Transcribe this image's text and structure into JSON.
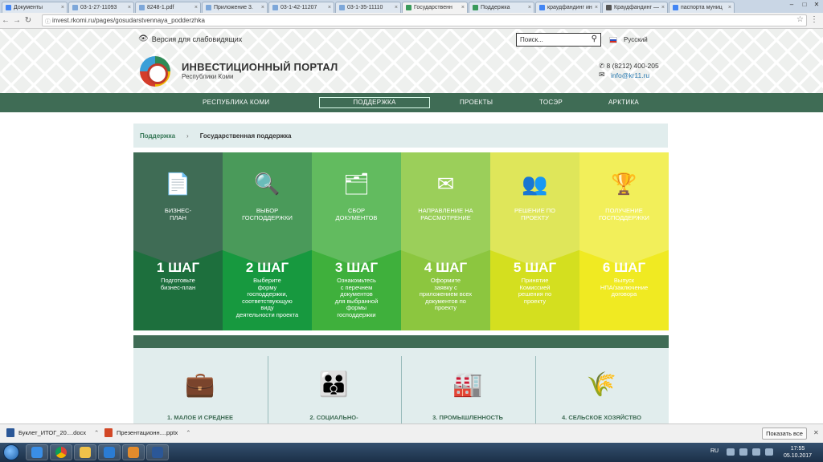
{
  "browser": {
    "tabs": [
      {
        "label": "Документы",
        "color": "#4285f4",
        "active": false
      },
      {
        "label": "03-1-27-11093",
        "color": "#7da7d9",
        "active": false
      },
      {
        "label": "8248-1.pdf",
        "color": "#7da7d9",
        "active": false
      },
      {
        "label": "Приложение 3.",
        "color": "#7da7d9",
        "active": false
      },
      {
        "label": "03-1-42-11207",
        "color": "#7da7d9",
        "active": false
      },
      {
        "label": "03-1-35-11110",
        "color": "#7da7d9",
        "active": false
      },
      {
        "label": "Государственн",
        "color": "#3a9a5b",
        "active": true
      },
      {
        "label": "Поддержка",
        "color": "#3a9a5b",
        "active": false
      },
      {
        "label": "краудфандинг ин",
        "color": "#4285f4",
        "active": false
      },
      {
        "label": "Краудфандинг —",
        "color": "#555555",
        "active": false
      },
      {
        "label": "паспорта муниц",
        "color": "#4285f4",
        "active": false
      }
    ],
    "url": "invest.rkomi.ru/pages/gosudarstvennaya_podderzhka"
  },
  "header": {
    "low_vision": "Версия для слабовидящих",
    "search_placeholder": "Поиск...",
    "language": "Русский",
    "site_title": "ИНВЕСТИЦИОННЫЙ ПОРТАЛ",
    "site_subtitle": "Республики Коми",
    "phone": "8 (8212) 400-205",
    "email": "info@kr11.ru"
  },
  "nav": {
    "items": [
      "РЕСПУБЛИКА КОМИ",
      "ПОДДЕРЖКА",
      "ПРОЕКТЫ",
      "ТОСЭР",
      "АРКТИКА"
    ],
    "active": "ПОДДЕРЖКА"
  },
  "breadcrumb": {
    "root": "Поддержка",
    "separator": "›",
    "current": "Государственная поддержка"
  },
  "steps": [
    {
      "icon": "business-plan-icon",
      "title": "БИЗНЕС-\nПЛАН",
      "step": "1 ШАГ",
      "desc": "Подготовьте\nбизнес-план",
      "top_color": "#3f6c55",
      "bottom_color": "#1d6f3d"
    },
    {
      "icon": "support-selection-icon",
      "title": "ВЫБОР\nГОСПОДДЕРЖКИ",
      "step": "2 ШАГ",
      "desc": "Выберите\nформу\nгосподдержки,\nсоответствующую\nвиду\nдеятельности проекта",
      "top_color": "#4a9a5a",
      "bottom_color": "#17993f"
    },
    {
      "icon": "documents-icon",
      "title": "СБОР\nДОКУМЕНТОВ",
      "step": "3 ШАГ",
      "desc": "Ознакомьтесь\nс перечнем\nдокументов\nдля выбранной\nформы\nгосподдержки",
      "top_color": "#62bb5f",
      "bottom_color": "#3fb03c"
    },
    {
      "icon": "application-icon",
      "title": "НАПРАВЛЕНИЕ НА\nРАССМОТРЕНИЕ",
      "step": "4 ШАГ",
      "desc": "Оформите\nзаявку с\nприложением всех\nдокументов по\nпроекту",
      "top_color": "#9bcf5a",
      "bottom_color": "#8cc63f"
    },
    {
      "icon": "commission-icon",
      "title": "РЕШЕНИЕ ПО\nПРОЕКТУ",
      "step": "5 ШАГ",
      "desc": "Принятие\nКомиссией\nрешения по\nпроекту",
      "top_color": "#dfe65a",
      "bottom_color": "#d4df1f"
    },
    {
      "icon": "award-icon",
      "title": "ПОЛУЧЕНИЕ\nГОСПОДДЕРЖКИ",
      "step": "6 ШАГ",
      "desc": "Выпуск\nНПА/заключение\nдоговора",
      "top_color": "#f2ef5a",
      "bottom_color": "#f0ea22"
    }
  ],
  "categories": [
    {
      "icon": "briefcase-icon",
      "label": "1. МАЛОЕ И СРЕДНЕЕ"
    },
    {
      "icon": "family-icon",
      "label": "2. СОЦИАЛЬНО-"
    },
    {
      "icon": "factory-icon",
      "label": "3. ПРОМЫШЛЕННОСТЬ"
    },
    {
      "icon": "wheat-icon",
      "label": "4. СЕЛЬСКОЕ ХОЗЯЙСТВО"
    }
  ],
  "downloads": {
    "items": [
      "Буклет_ИТОГ_20....docx",
      "Презентационн....pptx"
    ],
    "show_all": "Показать все"
  },
  "taskbar": {
    "lang": "RU",
    "time": "17:55",
    "date": "05.10.2017"
  }
}
